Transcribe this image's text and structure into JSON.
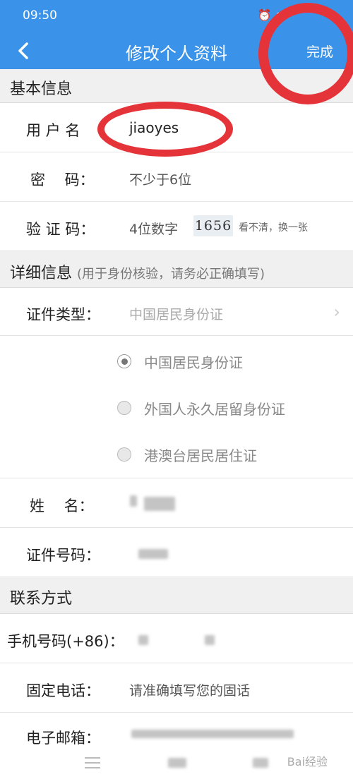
{
  "status_bar": {
    "time": "09:50",
    "icons": [
      "alarm-icon",
      "wifi-icon"
    ]
  },
  "nav": {
    "title": "修改个人资料",
    "done_label": "完成"
  },
  "basic": {
    "title": "基本信息",
    "username_label": "用 户 名",
    "username_value": "jiaoyes",
    "password_label": "密　 码：",
    "password_placeholder": "不少于6位",
    "captcha_label": "验 证 码：",
    "captcha_placeholder": "4位数字",
    "captcha_image_text": "1656",
    "captcha_refresh": "看不清，换一张"
  },
  "details": {
    "title": "详细信息",
    "note": "(用于身份核验，请务必正确填写)",
    "id_type_label": "证件类型：",
    "id_type_value": "中国居民身份证",
    "id_options": [
      {
        "label": "中国居民身份证",
        "checked": true
      },
      {
        "label": "外国人永久居留身份证",
        "checked": false
      },
      {
        "label": "港澳台居民居住证",
        "checked": false
      }
    ],
    "name_label": "姓　 名：",
    "id_number_label": "证件号码："
  },
  "contact": {
    "title": "联系方式",
    "mobile_label": "手机号码(+86)：",
    "landline_label": "固定电话：",
    "landline_placeholder": "请准确填写您的固话",
    "email_label": "电子邮箱："
  },
  "bottom": {
    "menu_icon": "menu-icon",
    "watermark": "Bai经验"
  },
  "colors": {
    "header_blue": "#3a93e8",
    "annotation_red": "#e5333a",
    "section_gray": "#f0f0f0"
  }
}
